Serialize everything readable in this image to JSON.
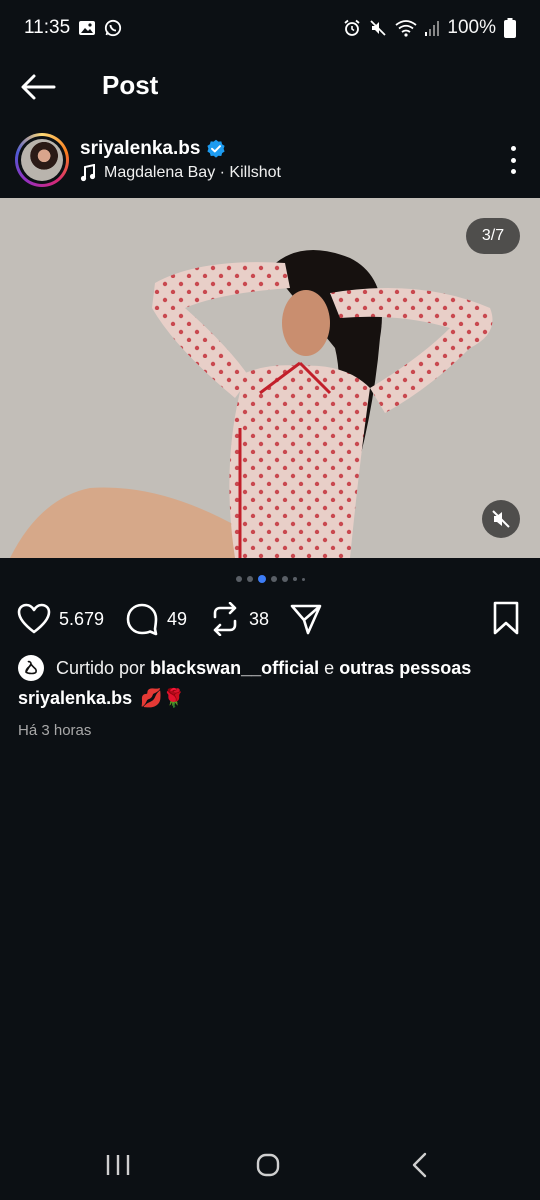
{
  "status_bar": {
    "time": "11:35",
    "battery": "100%",
    "left_icons": [
      "gallery-icon",
      "whatsapp-icon"
    ],
    "right_icons": [
      "alarm-icon",
      "mute-icon",
      "wifi-icon",
      "signal-icon",
      "battery-icon"
    ]
  },
  "header": {
    "title": "Post"
  },
  "post": {
    "username": "sriyalenka.bs",
    "verified": true,
    "music": "Magdalena Bay · Killshot",
    "media_counter": "3/7",
    "carousel": {
      "total_dots": 7,
      "active_index": 3
    },
    "likes": "5.679",
    "comments": "49",
    "reposts": "38",
    "liked_by_prefix": "Curtido por",
    "liked_by_user": "blackswan__official",
    "liked_by_connector": "e",
    "liked_by_suffix": "outras pessoas",
    "caption_user": "sriyalenka.bs",
    "caption_text": "💋🌹",
    "timestamp": "Há 3 horas"
  },
  "colors": {
    "background": "#0c1014",
    "verified": "#1d9bf0",
    "active_dot": "#3d7cf5",
    "muted_text": "#a8a8a8"
  }
}
